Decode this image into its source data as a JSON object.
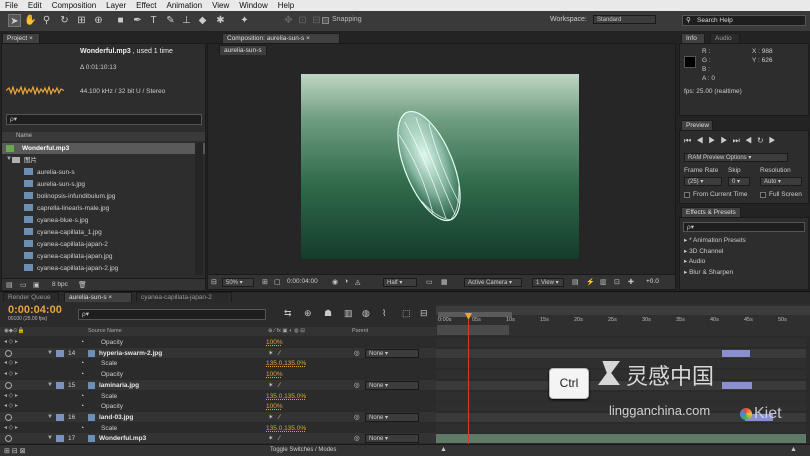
{
  "menu": [
    "File",
    "Edit",
    "Composition",
    "Layer",
    "Effect",
    "Animation",
    "View",
    "Window",
    "Help"
  ],
  "toolbar": {
    "snapping": "Snapping",
    "workspace_label": "Workspace:",
    "workspace_value": "Standard",
    "search_placeholder": "Search Help"
  },
  "project": {
    "tab": "Project",
    "selected_name": "Wonderful.mp3",
    "used": ", used 1 time",
    "duration": "Δ 0:01:10:13",
    "audio_info": "44.100 kHz / 32 bit U / Stereo",
    "search_placeholder": "ρ▾",
    "col_name": "Name",
    "items": [
      "Wonderful.mp3",
      "图片",
      "aurelia-sun-s",
      "aurelia-sun-s.jpg",
      "bolinopsis-infundibulum.jpg",
      "caprella-linearis-male.jpg",
      "cyanea-blue-s.jpg",
      "cyanea-capillata_1.jpg",
      "cyanea-capillata-japan-2",
      "cyanea-capillata-japan.jpg",
      "cyanea-capillata-japan-2.jpg"
    ],
    "bpc": "8 bpc"
  },
  "composition": {
    "tab": "Composition: aurelia-sun-s",
    "subtab": "aurelia-sun-s",
    "zoom": "50%",
    "timecode": "0:00:04:00",
    "resolution": "Half",
    "camera": "Active Camera",
    "view": "1 View",
    "exposure": "+0.0"
  },
  "info": {
    "tab_info": "Info",
    "tab_audio": "Audio",
    "r": "R :",
    "g": "G :",
    "b": "B :",
    "a": "A : 0",
    "x": "X : 988",
    "y": "Y : 626",
    "fps": "fps: 25.00 (realtime)"
  },
  "preview": {
    "tab": "Preview",
    "ram_options": "RAM Preview Options",
    "frame_rate_label": "Frame Rate",
    "skip_label": "Skip",
    "resolution_label": "Resolution",
    "frame_rate": "(25)",
    "skip": "0",
    "resolution": "Auto",
    "from_current": "From Current Time",
    "full_screen": "Full Screen"
  },
  "effects": {
    "tab": "Effects & Presets",
    "search_placeholder": "ρ▾",
    "items": [
      "* Animation Presets",
      "3D Channel",
      "Audio",
      "Blur & Sharpen"
    ]
  },
  "timeline": {
    "tabs": [
      "Render Queue",
      "aurelia-sun-s",
      "cyanea-capillata-japan-2"
    ],
    "timecode": "0:00:04:00",
    "sub_timecode": "00100 (25.00 fps)",
    "search_placeholder": "ρ▾",
    "col_source": "Source Name",
    "col_parent": "Parent",
    "ruler": [
      "0:00s",
      "05s",
      "10s",
      "15s",
      "20s",
      "25s",
      "30s",
      "35s",
      "40s",
      "45s",
      "50s"
    ],
    "rows": [
      {
        "kind": "prop",
        "name": "Opacity",
        "value": "100%"
      },
      {
        "kind": "layer",
        "num": "14",
        "name": "hyperia-swarm-2.jpg",
        "parent": "None"
      },
      {
        "kind": "prop",
        "name": "Scale",
        "value": "135.0,135.0%"
      },
      {
        "kind": "prop",
        "name": "Opacity",
        "value": "100%"
      },
      {
        "kind": "layer",
        "num": "15",
        "name": "laminaria.jpg",
        "parent": "None"
      },
      {
        "kind": "prop",
        "name": "Scale",
        "value": "135.0,135.0%"
      },
      {
        "kind": "prop",
        "name": "Opacity",
        "value": "100%"
      },
      {
        "kind": "layer",
        "num": "16",
        "name": "land-03.jpg",
        "parent": "None"
      },
      {
        "kind": "prop",
        "name": "Scale",
        "value": "135.0,135.0%"
      },
      {
        "kind": "layer",
        "num": "17",
        "name": "Wonderful.mp3",
        "parent": "None"
      }
    ],
    "toggle_label": "Toggle Switches / Modes",
    "key_overlay": "Ctrl"
  },
  "watermark": {
    "cn": "灵感中国",
    "url": "lingganchina.com",
    "brand": "Kiet"
  },
  "colors": {
    "accent": "#e8a33a",
    "timecode": "#e8a33a",
    "playhead": "#d63c2b"
  }
}
